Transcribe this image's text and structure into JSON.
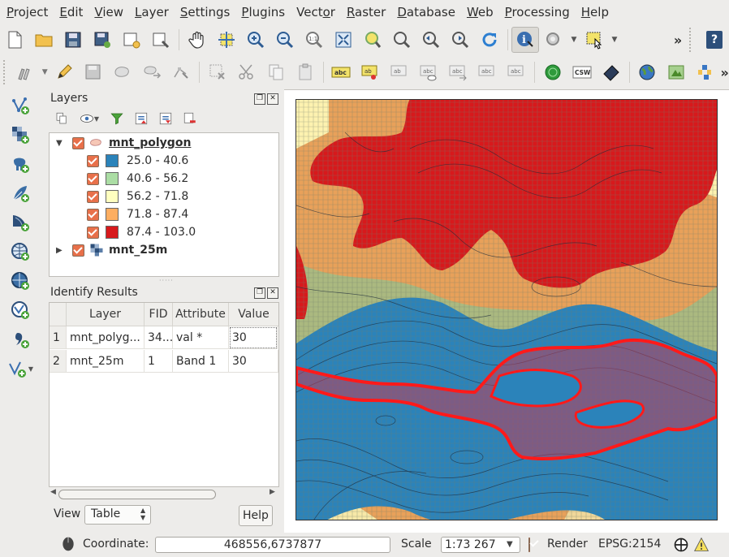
{
  "menu": [
    "Project",
    "Edit",
    "View",
    "Layer",
    "Settings",
    "Plugins",
    "Vector",
    "Raster",
    "Database",
    "Web",
    "Processing",
    "Help"
  ],
  "menu_mnemonics": [
    "P",
    "E",
    "V",
    "L",
    "S",
    "P",
    "o",
    "R",
    "D",
    "W",
    "P",
    "H"
  ],
  "toolbar": {
    "overflow_glyph": "»",
    "help_glyph": "?"
  },
  "layers_panel": {
    "title": "Layers",
    "layers": [
      {
        "name": "mnt_polygon",
        "classes": [
          {
            "label": "25.0 - 40.6",
            "color": "#2b83ba"
          },
          {
            "label": "40.6 - 56.2",
            "color": "#abdda4"
          },
          {
            "label": "56.2 - 71.8",
            "color": "#ffffbf"
          },
          {
            "label": "71.8 - 87.4",
            "color": "#fdae61"
          },
          {
            "label": "87.4 - 103.0",
            "color": "#d7191c"
          }
        ]
      },
      {
        "name": "mnt_25m"
      }
    ]
  },
  "identify_panel": {
    "title": "Identify Results",
    "columns": [
      "Layer",
      "FID",
      "Attribute",
      "Value"
    ],
    "rows": [
      {
        "num": "1",
        "layer": "mnt_polyg...",
        "fid": "34...",
        "attribute": "val *",
        "value": "30"
      },
      {
        "num": "2",
        "layer": "mnt_25m",
        "fid": "1",
        "attribute": "Band 1",
        "value": "30"
      }
    ],
    "view_label": "View",
    "view_value": "Table",
    "help_label": "Help"
  },
  "statusbar": {
    "coordinate_label": "Coordinate:",
    "coordinate_value": "468556,6737877",
    "scale_label": "Scale",
    "scale_value": "1:73 267",
    "render_label": "Render",
    "crs": "EPSG:2154"
  }
}
